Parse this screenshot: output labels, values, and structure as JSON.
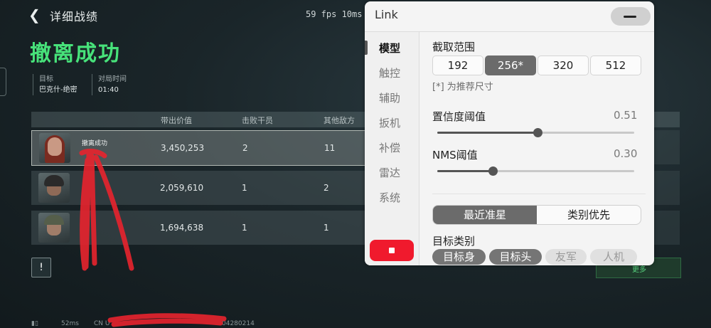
{
  "game": {
    "header_title": "详细战绩",
    "fps_stats": "59 fps  10ms",
    "result_title": "撤离成功",
    "meta": [
      {
        "label": "目标",
        "value": "巴克什-绝密"
      },
      {
        "label": "对局时间",
        "value": "01:40"
      }
    ],
    "table_headers": [
      "带出价值",
      "击败干员",
      "其他敌方"
    ],
    "rows": [
      {
        "status": "撤离成功",
        "value": "3,450,253",
        "kills": "2",
        "others": "11"
      },
      {
        "status": "",
        "value": "2,059,610",
        "kills": "1",
        "others": "2"
      },
      {
        "status": "",
        "value": "1,694,638",
        "kills": "1",
        "others": "1"
      }
    ],
    "warn_icon": "!",
    "more_label": "更多",
    "bottom_ping": "52ms",
    "bottom_region": "CN U",
    "bottom_id": "04280214"
  },
  "colors": {
    "result_green": "#47e27a",
    "stop_red": "#f01a2d",
    "marker_red": "#e8232e"
  },
  "panel": {
    "title": "Link",
    "minimize_icon": "minus-icon",
    "nav_items": [
      "模型",
      "触控",
      "辅助",
      "扳机",
      "补偿",
      "雷达",
      "系统"
    ],
    "active_nav": "模型",
    "capture_range": {
      "label": "截取范围",
      "options": [
        "192",
        "256*",
        "320",
        "512"
      ],
      "selected": "256*",
      "hint": "[*] 为推荐尺寸"
    },
    "confidence": {
      "label": "置信度阈值",
      "value_text": "0.51",
      "fraction": 0.51
    },
    "nms": {
      "label": "NMS阈值",
      "value_text": "0.30",
      "fraction": 0.28
    },
    "targeting_modes": [
      "最近准星",
      "类别优先"
    ],
    "targeting_selected": "最近准星",
    "target_class": {
      "label": "目标类别",
      "chips": [
        {
          "label": "目标身",
          "on": true
        },
        {
          "label": "目标头",
          "on": true
        },
        {
          "label": "友军",
          "on": false
        },
        {
          "label": "人机",
          "on": false
        }
      ]
    }
  }
}
